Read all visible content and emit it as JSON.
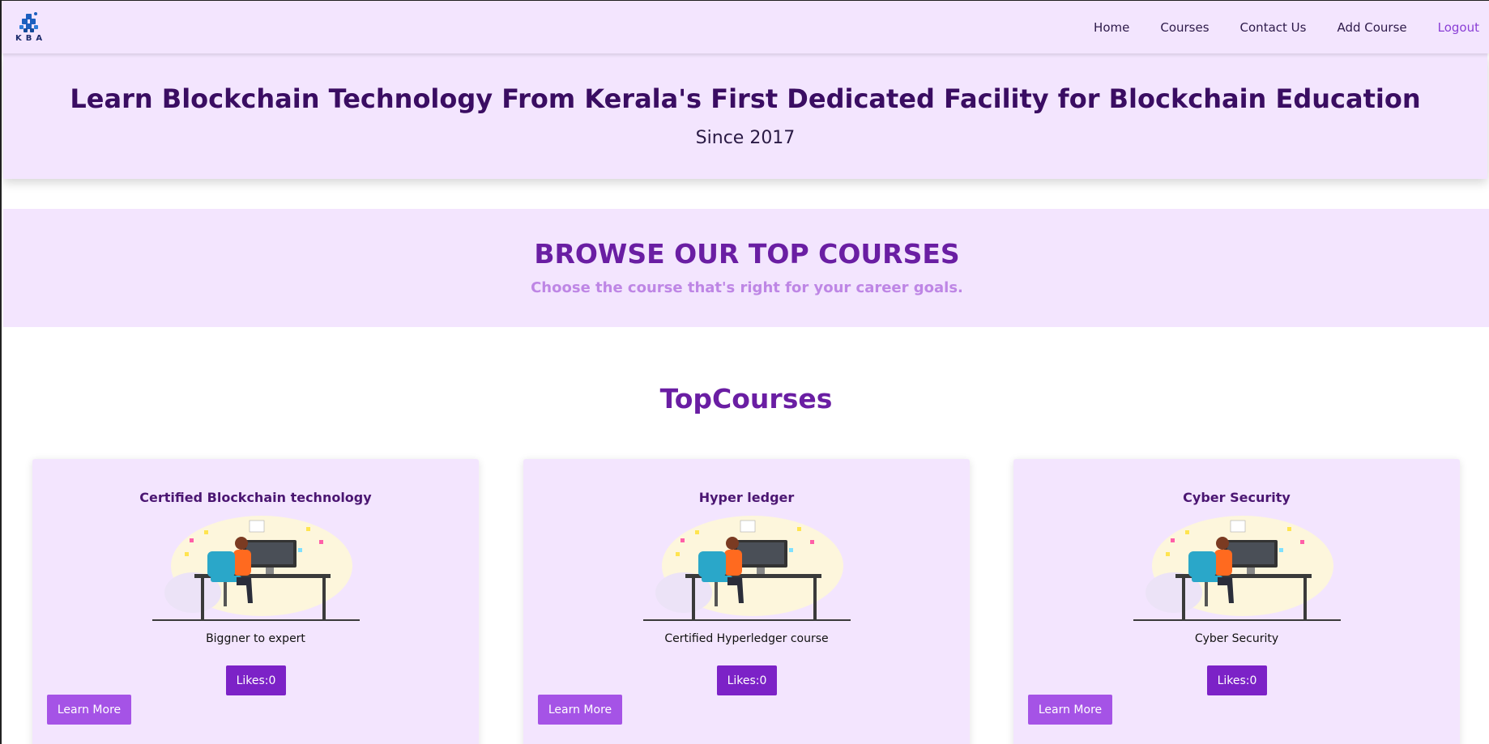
{
  "nav": {
    "logo_text": "KBA",
    "links": [
      "Home",
      "Courses",
      "Contact Us",
      "Add Course",
      "Logout"
    ]
  },
  "hero": {
    "title": "Learn Blockchain Technology From Kerala's First Dedicated Facility for Blockchain Education",
    "subtitle": "Since 2017"
  },
  "browse": {
    "title": "BROWSE OUR TOP COURSES",
    "subtitle": "Choose the course that's right for your career goals."
  },
  "top_courses": {
    "title": "TopCourses",
    "cards": [
      {
        "title": "Certified Blockchain technology",
        "description": "Biggner to expert",
        "likes_label": "Likes:0",
        "learn_label": "Learn More"
      },
      {
        "title": "Hyper ledger",
        "description": "Certified Hyperledger course",
        "likes_label": "Likes:0",
        "learn_label": "Learn More"
      },
      {
        "title": "Cyber Security",
        "description": "Cyber Security",
        "likes_label": "Likes:0",
        "learn_label": "Learn More"
      }
    ]
  },
  "colors": {
    "nav_bg": "#f3e5fe",
    "primary_purple": "#6a1ea3",
    "button_dark": "#7c22c7",
    "button_light": "#a553e6"
  },
  "icons": {
    "logo": "kba-logo-icon",
    "card_image": "developer-at-desk-illustration"
  }
}
